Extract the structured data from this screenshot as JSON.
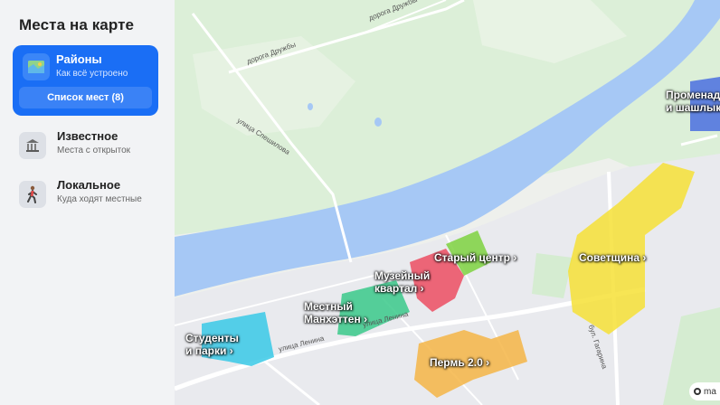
{
  "sidebar": {
    "title": "Места на карте",
    "active_card": {
      "title": "Районы",
      "subtitle": "Как всё устроено",
      "button": "Список мест (8)",
      "icon": "map-icon"
    },
    "cards": [
      {
        "title": "Известное",
        "subtitle": "Места с открыток",
        "icon": "museum-icon"
      },
      {
        "title": "Локальное",
        "subtitle": "Куда ходят местные",
        "icon": "walking-person-icon"
      }
    ]
  },
  "map": {
    "road_labels": {
      "druzhby1": "дорога Дружбы",
      "druzhby2": "дорога Дружбы",
      "speshilova": "улица Спешилова",
      "lenina1": "улица Ленина",
      "lenina2": "улица Ленина",
      "gagarina": "бул. Гагарина"
    },
    "districts": [
      {
        "name": "Старый центр",
        "color": "#7ed23f"
      },
      {
        "name": "Музейный квартал",
        "color": "#ec4d62"
      },
      {
        "name": "Местный Манхэттен",
        "color": "#39c98a"
      },
      {
        "name": "Студенты и парки",
        "color": "#38c9e6"
      },
      {
        "name": "Пермь 2.0",
        "color": "#f5b545"
      },
      {
        "name": "Советщина",
        "color": "#f6e036"
      },
      {
        "name": "Променад и шашлыки",
        "color": "#4a6ee0"
      }
    ],
    "labels": {
      "stary": "Старый центр",
      "muzey1": "Музейный",
      "muzey2": "квартал",
      "manh1": "Местный",
      "manh2": "Манхэттен",
      "stud1": "Студенты",
      "stud2": "и парки",
      "perm": "Пермь 2.0",
      "sovet": "Советщина",
      "prom1": "Променад",
      "prom2": "и шашлыки"
    },
    "chevron": "›",
    "logo_text": "ma"
  }
}
